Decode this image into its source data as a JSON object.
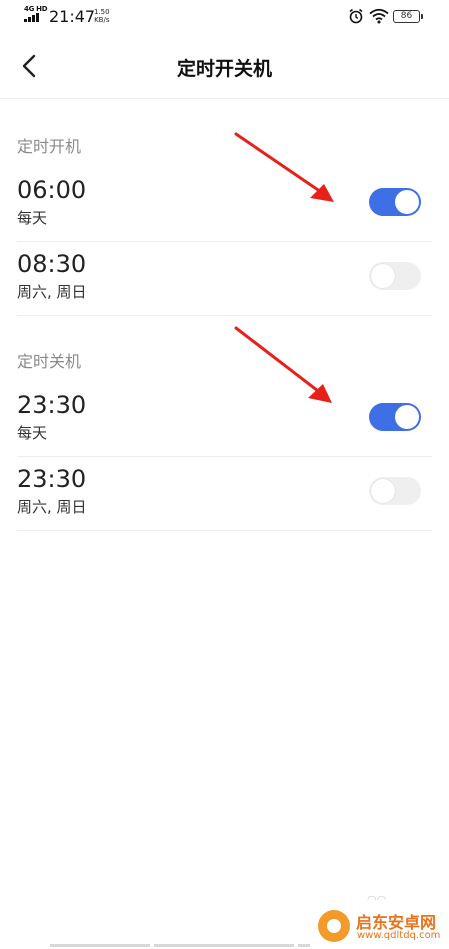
{
  "status_bar": {
    "network_type": "4G HD",
    "time": "21:47",
    "speed_value": "1.50",
    "speed_unit": "KB/s",
    "battery": "86",
    "icons": [
      "signal-icon",
      "alarm-icon",
      "wifi-icon",
      "battery-icon"
    ]
  },
  "header": {
    "title": "定时开关机",
    "back_icon": "chevron-left-icon"
  },
  "sections": [
    {
      "label": "定时开机",
      "rows": [
        {
          "time": "06:00",
          "repeat": "每天",
          "enabled": true
        },
        {
          "time": "08:30",
          "repeat": "周六, 周日",
          "enabled": false
        }
      ]
    },
    {
      "label": "定时关机",
      "rows": [
        {
          "time": "23:30",
          "repeat": "每天",
          "enabled": true
        },
        {
          "time": "23:30",
          "repeat": "周六, 周日",
          "enabled": false
        }
      ]
    }
  ],
  "annotations": {
    "arrow_color": "#e8201a"
  },
  "watermark": {
    "name": "启东安卓网",
    "url": "www.qdltdq.com"
  },
  "colors": {
    "toggle_on": "#3f6fe5",
    "toggle_off": "#efefef",
    "section_label": "#8a8a8a"
  }
}
